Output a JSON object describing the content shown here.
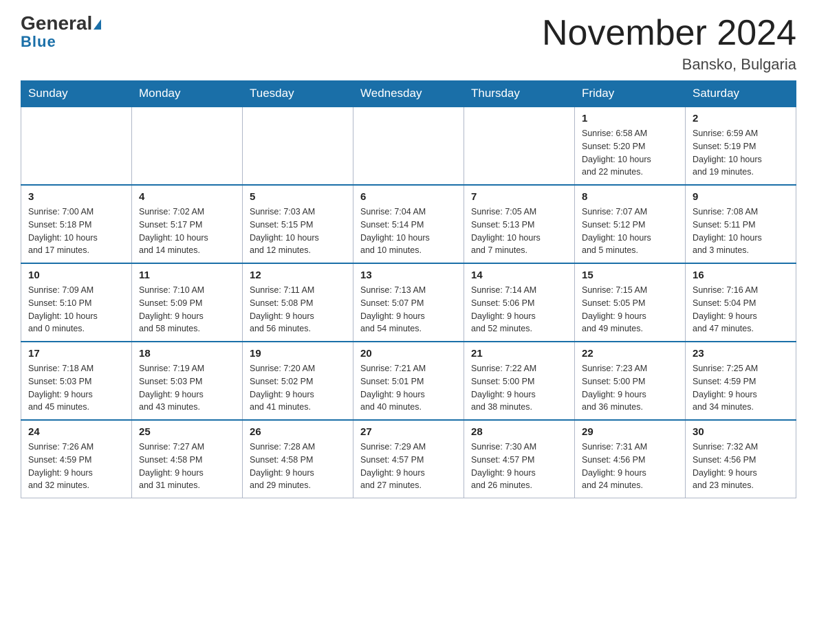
{
  "header": {
    "logo_general": "General",
    "logo_blue": "Blue",
    "title": "November 2024",
    "subtitle": "Bansko, Bulgaria"
  },
  "weekdays": [
    "Sunday",
    "Monday",
    "Tuesday",
    "Wednesday",
    "Thursday",
    "Friday",
    "Saturday"
  ],
  "weeks": [
    [
      {
        "day": "",
        "info": ""
      },
      {
        "day": "",
        "info": ""
      },
      {
        "day": "",
        "info": ""
      },
      {
        "day": "",
        "info": ""
      },
      {
        "day": "",
        "info": ""
      },
      {
        "day": "1",
        "info": "Sunrise: 6:58 AM\nSunset: 5:20 PM\nDaylight: 10 hours\nand 22 minutes."
      },
      {
        "day": "2",
        "info": "Sunrise: 6:59 AM\nSunset: 5:19 PM\nDaylight: 10 hours\nand 19 minutes."
      }
    ],
    [
      {
        "day": "3",
        "info": "Sunrise: 7:00 AM\nSunset: 5:18 PM\nDaylight: 10 hours\nand 17 minutes."
      },
      {
        "day": "4",
        "info": "Sunrise: 7:02 AM\nSunset: 5:17 PM\nDaylight: 10 hours\nand 14 minutes."
      },
      {
        "day": "5",
        "info": "Sunrise: 7:03 AM\nSunset: 5:15 PM\nDaylight: 10 hours\nand 12 minutes."
      },
      {
        "day": "6",
        "info": "Sunrise: 7:04 AM\nSunset: 5:14 PM\nDaylight: 10 hours\nand 10 minutes."
      },
      {
        "day": "7",
        "info": "Sunrise: 7:05 AM\nSunset: 5:13 PM\nDaylight: 10 hours\nand 7 minutes."
      },
      {
        "day": "8",
        "info": "Sunrise: 7:07 AM\nSunset: 5:12 PM\nDaylight: 10 hours\nand 5 minutes."
      },
      {
        "day": "9",
        "info": "Sunrise: 7:08 AM\nSunset: 5:11 PM\nDaylight: 10 hours\nand 3 minutes."
      }
    ],
    [
      {
        "day": "10",
        "info": "Sunrise: 7:09 AM\nSunset: 5:10 PM\nDaylight: 10 hours\nand 0 minutes."
      },
      {
        "day": "11",
        "info": "Sunrise: 7:10 AM\nSunset: 5:09 PM\nDaylight: 9 hours\nand 58 minutes."
      },
      {
        "day": "12",
        "info": "Sunrise: 7:11 AM\nSunset: 5:08 PM\nDaylight: 9 hours\nand 56 minutes."
      },
      {
        "day": "13",
        "info": "Sunrise: 7:13 AM\nSunset: 5:07 PM\nDaylight: 9 hours\nand 54 minutes."
      },
      {
        "day": "14",
        "info": "Sunrise: 7:14 AM\nSunset: 5:06 PM\nDaylight: 9 hours\nand 52 minutes."
      },
      {
        "day": "15",
        "info": "Sunrise: 7:15 AM\nSunset: 5:05 PM\nDaylight: 9 hours\nand 49 minutes."
      },
      {
        "day": "16",
        "info": "Sunrise: 7:16 AM\nSunset: 5:04 PM\nDaylight: 9 hours\nand 47 minutes."
      }
    ],
    [
      {
        "day": "17",
        "info": "Sunrise: 7:18 AM\nSunset: 5:03 PM\nDaylight: 9 hours\nand 45 minutes."
      },
      {
        "day": "18",
        "info": "Sunrise: 7:19 AM\nSunset: 5:03 PM\nDaylight: 9 hours\nand 43 minutes."
      },
      {
        "day": "19",
        "info": "Sunrise: 7:20 AM\nSunset: 5:02 PM\nDaylight: 9 hours\nand 41 minutes."
      },
      {
        "day": "20",
        "info": "Sunrise: 7:21 AM\nSunset: 5:01 PM\nDaylight: 9 hours\nand 40 minutes."
      },
      {
        "day": "21",
        "info": "Sunrise: 7:22 AM\nSunset: 5:00 PM\nDaylight: 9 hours\nand 38 minutes."
      },
      {
        "day": "22",
        "info": "Sunrise: 7:23 AM\nSunset: 5:00 PM\nDaylight: 9 hours\nand 36 minutes."
      },
      {
        "day": "23",
        "info": "Sunrise: 7:25 AM\nSunset: 4:59 PM\nDaylight: 9 hours\nand 34 minutes."
      }
    ],
    [
      {
        "day": "24",
        "info": "Sunrise: 7:26 AM\nSunset: 4:59 PM\nDaylight: 9 hours\nand 32 minutes."
      },
      {
        "day": "25",
        "info": "Sunrise: 7:27 AM\nSunset: 4:58 PM\nDaylight: 9 hours\nand 31 minutes."
      },
      {
        "day": "26",
        "info": "Sunrise: 7:28 AM\nSunset: 4:58 PM\nDaylight: 9 hours\nand 29 minutes."
      },
      {
        "day": "27",
        "info": "Sunrise: 7:29 AM\nSunset: 4:57 PM\nDaylight: 9 hours\nand 27 minutes."
      },
      {
        "day": "28",
        "info": "Sunrise: 7:30 AM\nSunset: 4:57 PM\nDaylight: 9 hours\nand 26 minutes."
      },
      {
        "day": "29",
        "info": "Sunrise: 7:31 AM\nSunset: 4:56 PM\nDaylight: 9 hours\nand 24 minutes."
      },
      {
        "day": "30",
        "info": "Sunrise: 7:32 AM\nSunset: 4:56 PM\nDaylight: 9 hours\nand 23 minutes."
      }
    ]
  ]
}
